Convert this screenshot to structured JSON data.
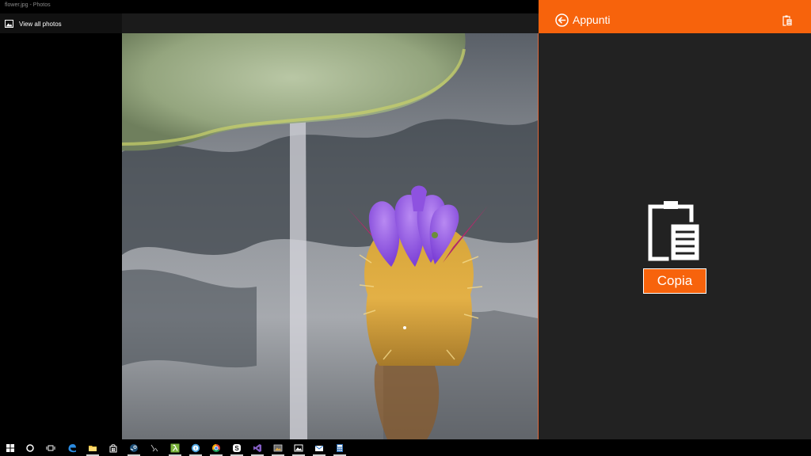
{
  "photos_window": {
    "title": "flower.jpg - Photos",
    "view_all_label": "View all photos"
  },
  "clipboard_app": {
    "header_title": "Appunti",
    "copy_button_label": "Copia",
    "accent_color": "#f7630c",
    "background_color": "#222222"
  },
  "taskbar": {
    "items": [
      {
        "name": "start-icon"
      },
      {
        "name": "cortana-icon"
      },
      {
        "name": "task-view-icon"
      },
      {
        "name": "edge-icon"
      },
      {
        "name": "file-explorer-icon"
      },
      {
        "name": "store-icon"
      },
      {
        "name": "steam-icon"
      },
      {
        "name": "app-icon"
      },
      {
        "name": "lambda-app-icon"
      },
      {
        "name": "info-app-icon"
      },
      {
        "name": "chrome-icon"
      },
      {
        "name": "skype-icon"
      },
      {
        "name": "visual-studio-icon"
      },
      {
        "name": "image-app-icon"
      },
      {
        "name": "photos-icon"
      },
      {
        "name": "mail-icon"
      },
      {
        "name": "calculator-icon"
      }
    ]
  }
}
